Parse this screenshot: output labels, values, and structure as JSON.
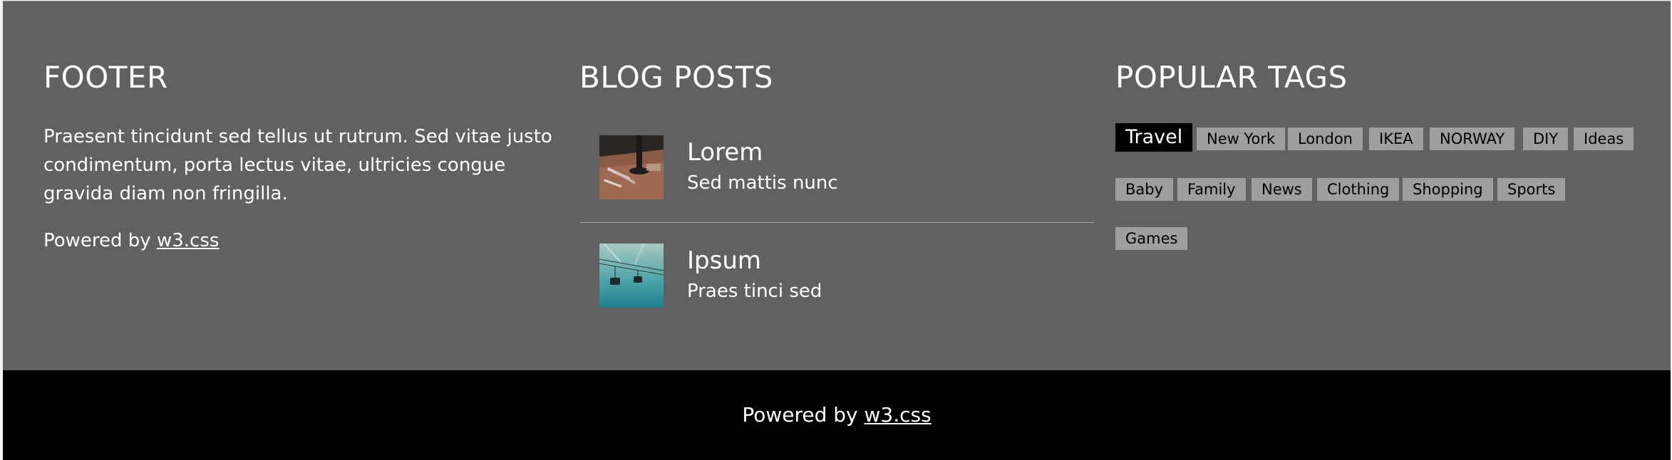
{
  "footer": {
    "heading": "FOOTER",
    "text": "Praesent tincidunt sed tellus ut rutrum. Sed vitae justo condimentum, porta lectus vitae, ultricies congue gravida diam non fringilla.",
    "powered_prefix": "Powered by ",
    "powered_link": "w3.css"
  },
  "blog": {
    "heading": "BLOG POSTS",
    "posts": [
      {
        "title": "Lorem",
        "subtitle": "Sed mattis nunc",
        "image": "workbench-photo"
      },
      {
        "title": "Ipsum",
        "subtitle": "Praes tinci sed",
        "image": "gondola-photo"
      }
    ]
  },
  "tags": {
    "heading": "POPULAR TAGS",
    "items": [
      "Travel",
      "New York",
      "London",
      "IKEA",
      "NORWAY",
      "DIY",
      "Ideas",
      "Baby",
      "Family",
      "News",
      "Clothing",
      "Shopping",
      "Sports",
      "Games"
    ],
    "active": "Travel"
  },
  "bottom": {
    "powered_prefix": "Powered by ",
    "powered_link": "w3.css"
  },
  "colors": {
    "footer_bg": "#616161",
    "bottom_bg": "#000000",
    "tag_bg": "#9e9e9e",
    "tag_active_bg": "#000000"
  }
}
